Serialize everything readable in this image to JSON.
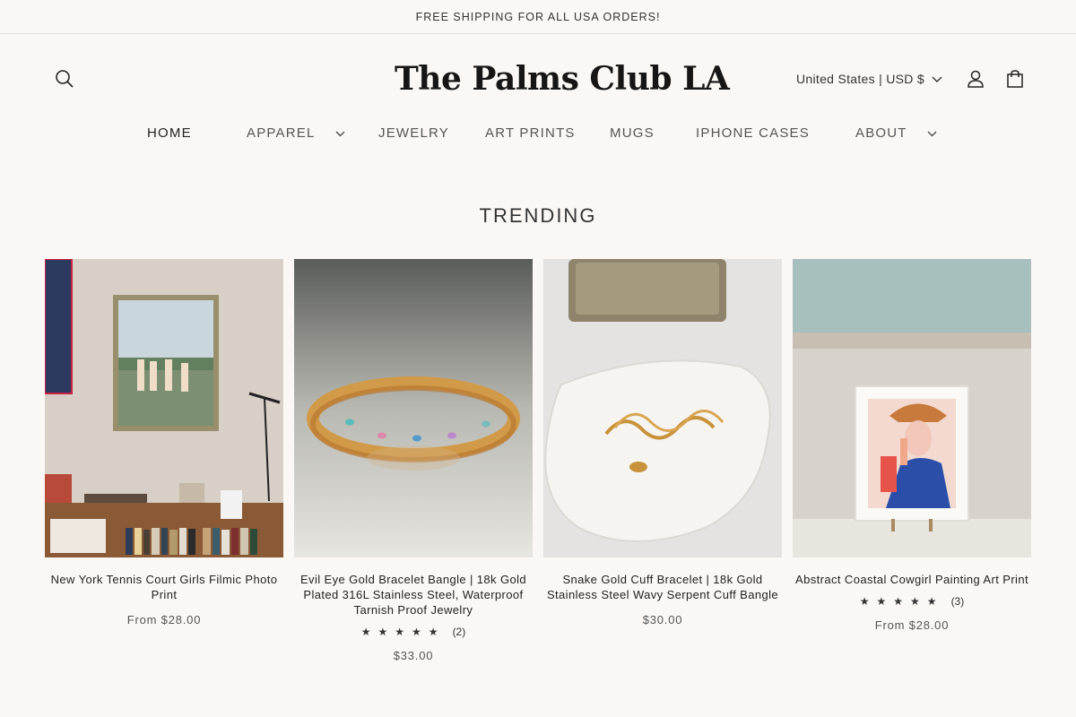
{
  "announcement": "FREE SHIPPING FOR ALL USA ORDERS!",
  "header": {
    "logo": "The Palms Club LA",
    "country": "United States | USD $"
  },
  "nav": {
    "home": "HOME",
    "apparel": "APPAREL",
    "jewelry": "JEWELRY",
    "art_prints": "ART PRINTS",
    "mugs": "MUGS",
    "iphone_cases": "IPHONE CASES",
    "about": "ABOUT"
  },
  "section": {
    "title": "TRENDING"
  },
  "products": [
    {
      "title": "New York Tennis Court Girls Filmic Photo Print",
      "price": "From $28.00"
    },
    {
      "title": "Evil Eye Gold Bracelet Bangle | 18k Gold Plated 316L Stainless Steel, Waterproof Tarnish Proof Jewelry",
      "stars": "★★★★★",
      "reviews": "(2)",
      "price": "$33.00"
    },
    {
      "title": "Snake Gold Cuff Bracelet | 18k Gold Stainless Steel Wavy Serpent Cuff Bangle",
      "price": "$30.00"
    },
    {
      "title": "Abstract Coastal Cowgirl Painting Art Print",
      "stars": "★★★★★",
      "reviews": "(3)",
      "price": "From $28.00"
    }
  ],
  "colors": {
    "background": "#fbf7f4",
    "text": "#2a2a2a",
    "gold": "#c9923a"
  }
}
